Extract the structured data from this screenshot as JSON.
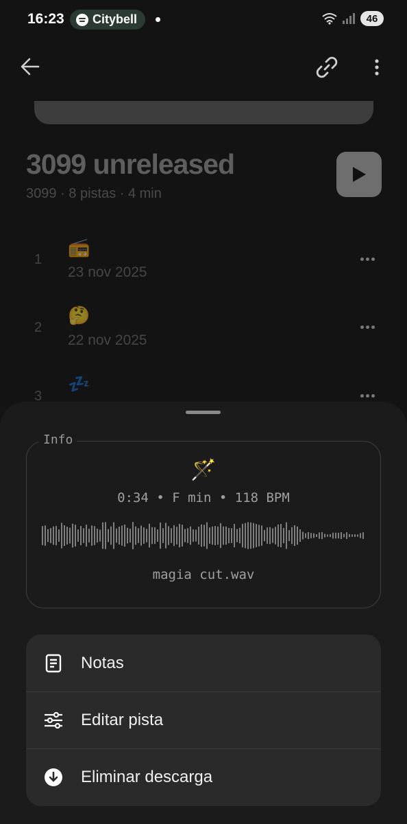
{
  "status_bar": {
    "time": "16:23",
    "now_playing_app": "Citybell",
    "battery": "46"
  },
  "playlist": {
    "title": "3099 unreleased",
    "meta": "3099 · 8 pistas · 4 min"
  },
  "tracks": [
    {
      "number": "1",
      "emoji": "📻",
      "date": "23 nov 2025"
    },
    {
      "number": "2",
      "emoji": "🤔",
      "date": "22 nov 2025"
    },
    {
      "number": "3",
      "emoji": "💤",
      "date": ""
    }
  ],
  "sheet": {
    "info_legend": "Info",
    "track_emoji": "🪄",
    "track_meta": "0:34 • F min • 118 BPM",
    "file_name": "magia cut.wav",
    "menu": [
      {
        "label": "Notas",
        "icon": "notes-icon"
      },
      {
        "label": "Editar pista",
        "icon": "sliders-icon"
      },
      {
        "label": "Eliminar descarga",
        "icon": "download-remove-icon"
      }
    ]
  },
  "colors": {
    "accent_pill": "#2b3a32",
    "sheet_bg": "#1b1b1b",
    "menu_bg": "#2a2a2a"
  }
}
